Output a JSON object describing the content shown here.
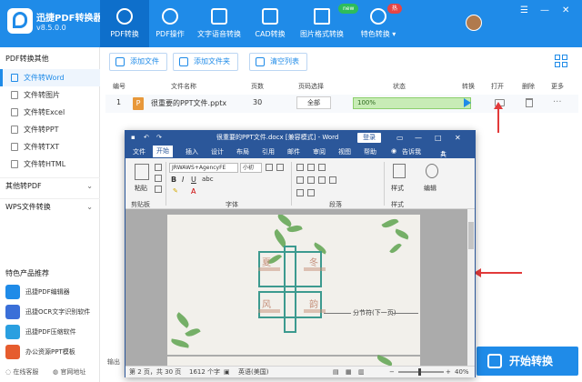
{
  "app": {
    "name": "迅捷PDF转换器",
    "version": "v8.5.0.0"
  },
  "nav": {
    "tabs": [
      {
        "label": "PDF转换",
        "active": true
      },
      {
        "label": "PDF操作"
      },
      {
        "label": "文字语音转换"
      },
      {
        "label": "CAD转换"
      },
      {
        "label": "图片格式转换",
        "badge": "new"
      },
      {
        "label": "特色转换 ▾",
        "badge": "热"
      }
    ],
    "window_controls": [
      "☰",
      "—",
      "✕"
    ]
  },
  "sidebar": {
    "group_pdf_to_other": "PDF转换其他",
    "items": [
      {
        "label": "文件转Word",
        "active": true
      },
      {
        "label": "文件转图片"
      },
      {
        "label": "文件转Excel"
      },
      {
        "label": "文件转PPT"
      },
      {
        "label": "文件转TXT"
      },
      {
        "label": "文件转HTML"
      }
    ],
    "group_other_to_pdf": "其他转PDF",
    "group_wps": "WPS文件转换",
    "chevron": "⌄",
    "features_title": "特色产品推荐",
    "features": [
      {
        "label": "迅捷PDF编辑器",
        "color": "#1f8be8"
      },
      {
        "label": "迅捷OCR文字识别软件",
        "color": "#3a6fd8"
      },
      {
        "label": "迅捷PDF压缩软件",
        "color": "#2a9fe0"
      },
      {
        "label": "办公资源PPT模板",
        "color": "#e65c2e"
      }
    ],
    "online_service": "在线客服",
    "official_site": "官网地址"
  },
  "toolbar": {
    "add_file": "添加文件",
    "add_folder": "添加文件夹",
    "clear_list": "清空列表"
  },
  "table": {
    "headers": [
      "编号",
      "文件名称",
      "页数",
      "页码选择",
      "状态",
      "转换",
      "打开",
      "删除",
      "更多"
    ],
    "rows": [
      {
        "index": "1",
        "icon": "P",
        "name": "很重要的PPT文件.pptx",
        "pages": "30",
        "page_select": "全部",
        "status": "100%",
        "progress": 1.0,
        "more": "···"
      }
    ]
  },
  "output_label": "输出",
  "start_button": "开始转换",
  "word": {
    "title": "很重要的PPT文件.docx [兼容模式] - Word",
    "login": "登录",
    "controls": [
      "▭",
      "—",
      "□",
      "✕"
    ],
    "tabs": [
      "文件",
      "开始",
      "插入",
      "设计",
      "布局",
      "引用",
      "邮件",
      "审阅",
      "视图",
      "帮助",
      "告诉我",
      "共享"
    ],
    "active_tab": "开始",
    "tell_me_icon": "lightbulb-icon",
    "ribbon": {
      "paste": "粘贴",
      "font_name": "JRWAWS+AgencyFE",
      "font_size": "小初",
      "styles": "样式",
      "editing": "编辑",
      "groups": [
        "剪贴板",
        "字体",
        "段落",
        "样式"
      ]
    },
    "doc": {
      "chars": [
        "夏",
        "冬",
        "风",
        "韵"
      ],
      "toc_entry": "分节符(下一页)"
    },
    "status": {
      "page": "第 2 页，共 30 页",
      "words": "1612 个字",
      "lang": "英语(美国)",
      "zoom": "40%",
      "minus": "−",
      "plus": "+"
    }
  },
  "colors": {
    "primary": "#1f8be8",
    "word_blue": "#2b579a",
    "arrow_red": "#e23a3a",
    "progress_green": "#c8ecb6"
  }
}
